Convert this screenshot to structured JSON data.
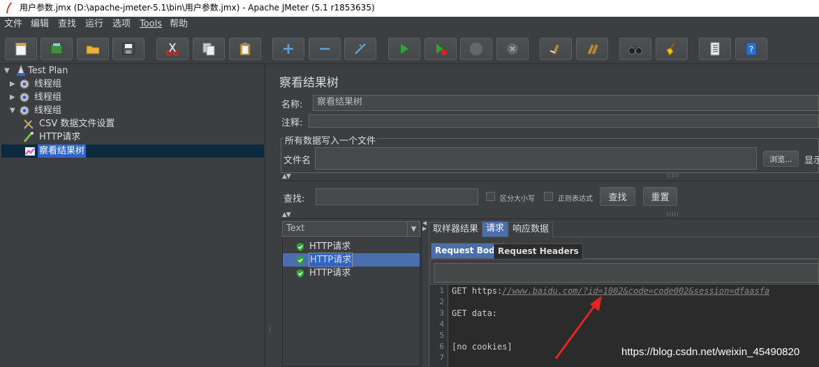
{
  "window": {
    "title": "用户参数.jmx (D:\\apache-jmeter-5.1\\bin\\用户参数.jmx) - Apache JMeter (5.1 r1853635)"
  },
  "menu": [
    "文件",
    "编辑",
    "查找",
    "运行",
    "选项",
    "Tools",
    "帮助"
  ],
  "toolbar": {
    "buttons": [
      "new-icon",
      "templates-icon",
      "open-icon",
      "save-icon",
      "cut-icon",
      "copy-icon",
      "paste-icon",
      "expand-icon",
      "collapse-icon",
      "toggle-icon",
      "start-icon",
      "start-no-pause-icon",
      "stop-icon",
      "shutdown-icon",
      "clear-icon",
      "clear-all-icon",
      "search-icon",
      "reset-search-icon",
      "function-helper-icon",
      "help-icon"
    ]
  },
  "tree": {
    "root": "Test Plan",
    "thread_groups": [
      "线程组",
      "线程组",
      "线程组"
    ],
    "children": [
      "CSV 数据文件设置",
      "HTTP请求",
      "察看结果树"
    ]
  },
  "panel": {
    "title": "察看结果树",
    "name_label": "名称:",
    "name_value": "察看结果树",
    "comment_label": "注释:",
    "fieldset_legend": "所有数据写入一个文件",
    "filename_label": "文件名",
    "browse_button": "浏览...",
    "display_label": "显示",
    "search_label": "查找:",
    "case_sensitive": "区分大小写",
    "regex": "正则表达式",
    "find_button": "查找",
    "reset_button": "重置"
  },
  "results": {
    "renderer": "Text",
    "items": [
      "HTTP请求",
      "HTTP请求",
      "HTTP请求"
    ],
    "selected_index": 1
  },
  "tabs": [
    "取样器结果",
    "请求",
    "响应数据"
  ],
  "active_tab": "请求",
  "subtabs": [
    "Request Body",
    "Request Headers"
  ],
  "active_subtab": "Request Body",
  "editor": {
    "line_numbers": [
      "1",
      "2",
      "3",
      "4",
      "5",
      "6",
      "7"
    ],
    "line1_prefix": "GET https:",
    "line1_url": "//www.baidu.com/?id=1002&code=code002&session=dfaasfa",
    "line3": "GET data:",
    "line6": "[no cookies]"
  },
  "watermark": "https://blog.csdn.net/weixin_45490820"
}
